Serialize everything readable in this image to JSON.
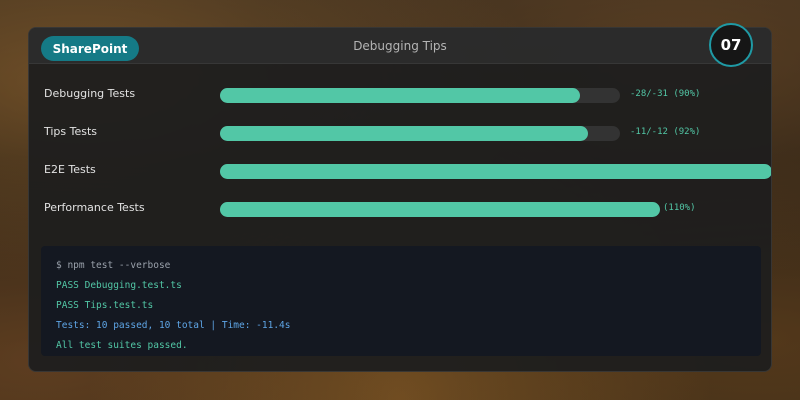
{
  "header": {
    "brand_label": "SharePoint",
    "title": "Debugging Tips",
    "step_badge": "07"
  },
  "metrics": [
    {
      "label": "Debugging Tests",
      "value_text": "-28/-31 (90%)",
      "fill_fraction": 0.9
    },
    {
      "label": "Tips Tests",
      "value_text": "-11/-12 (92%)",
      "fill_fraction": 0.92
    },
    {
      "label": "E2E Tests",
      "value_text": "",
      "fill_fraction": 1.38
    },
    {
      "label": "Performance Tests",
      "value_text": "(110%)",
      "fill_fraction": 1.1
    }
  ],
  "console": {
    "lines": [
      {
        "text": "$ npm test --verbose",
        "kind": "cmd"
      },
      {
        "text": "PASS Debugging.test.ts",
        "kind": "pass"
      },
      {
        "text": "PASS Tips.test.ts",
        "kind": "pass"
      },
      {
        "text": "Tests: 10 passed, 10 total | Time: -11.4s",
        "kind": "info"
      },
      {
        "text": "All test suites passed.",
        "kind": "pass"
      }
    ]
  },
  "colors": {
    "accent": "#52c7a6",
    "brand": "#157a86",
    "badge_ring": "#1f9aa5",
    "info": "#5ea5e6"
  }
}
